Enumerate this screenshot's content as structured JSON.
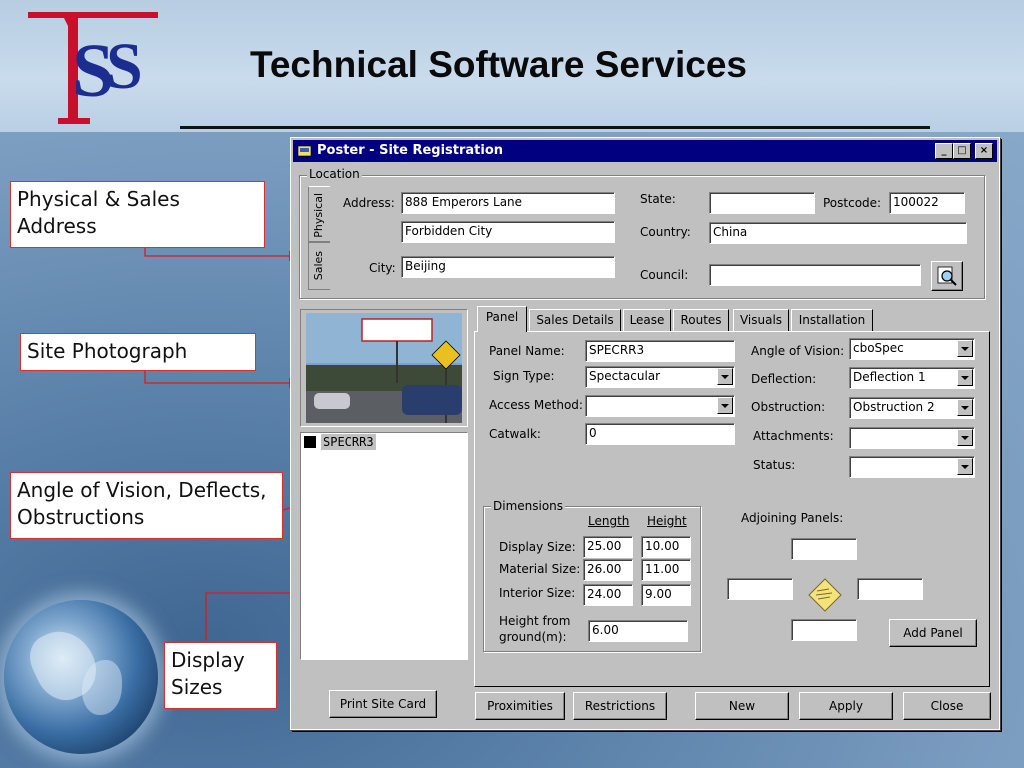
{
  "slide": {
    "title": "Technical Software Services",
    "logo_text": "TSS",
    "colors": {
      "logo_red": "#c8102e",
      "logo_blue": "#1b2d8f",
      "callout_border": "#d63030"
    }
  },
  "callouts": {
    "address": "Physical & Sales Address",
    "photo": "Site Photograph",
    "angle": "Angle of Vision, Deflects, Obstructions",
    "display": "Display Sizes"
  },
  "window": {
    "title": "Poster - Site Registration",
    "minimize": "_",
    "maximize": "□",
    "close": "×"
  },
  "location": {
    "group_label": "Location",
    "tabs": [
      "Physical",
      "Sales"
    ],
    "address_label": "Address:",
    "address_line1": "888 Emperors Lane",
    "address_line2": "Forbidden City",
    "city_label": "City:",
    "city": "Beijing",
    "state_label": "State:",
    "state": "",
    "postcode_label": "Postcode:",
    "postcode": "100022",
    "country_label": "Country:",
    "country": "China",
    "council_label": "Council:",
    "council": ""
  },
  "site_list": [
    "SPECRR3"
  ],
  "tabs": [
    "Panel",
    "Sales Details",
    "Lease",
    "Routes",
    "Visuals",
    "Installation"
  ],
  "panel": {
    "panel_name_label": "Panel Name:",
    "panel_name": "SPECRR3",
    "sign_type_label": "Sign Type:",
    "sign_type": "Spectacular",
    "access_method_label": "Access Method:",
    "access_method": "",
    "catwalk_label": "Catwalk:",
    "catwalk": "0",
    "angle_label": "Angle of Vision:",
    "angle": "cboSpec",
    "deflection_label": "Deflection:",
    "deflection": "Deflection 1",
    "obstruction_label": "Obstruction:",
    "obstruction": "Obstruction 2",
    "attachments_label": "Attachments:",
    "attachments": "",
    "status_label": "Status:",
    "status": ""
  },
  "dimensions": {
    "group_label": "Dimensions",
    "length_header": "Length",
    "height_header": "Height",
    "rows": [
      {
        "label": "Display Size:",
        "length": "25.00",
        "height": "10.00"
      },
      {
        "label": "Material Size:",
        "length": "26.00",
        "height": "11.00"
      },
      {
        "label": "Interior Size:",
        "length": "24.00",
        "height": "9.00"
      }
    ],
    "height_ground_label_1": "Height from",
    "height_ground_label_2": "ground(m):",
    "height_ground": "6.00"
  },
  "adjoining": {
    "label": "Adjoining Panels:",
    "add_panel": "Add Panel",
    "top": "",
    "left": "",
    "right": "",
    "bottom": ""
  },
  "buttons": {
    "print_site_card": "Print Site Card",
    "proximities": "Proximities",
    "restrictions": "Restrictions",
    "new": "New",
    "apply": "Apply",
    "close": "Close"
  }
}
